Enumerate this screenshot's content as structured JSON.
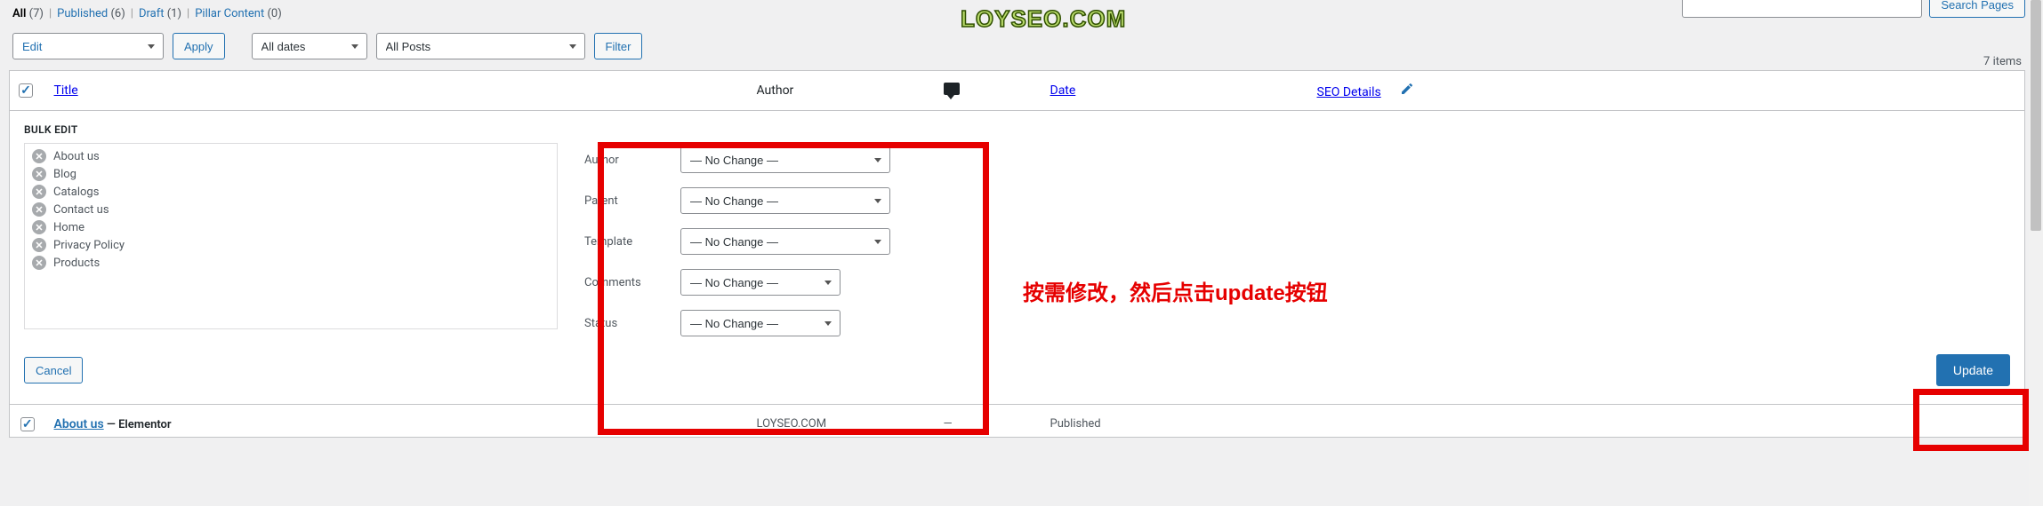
{
  "filters": {
    "all_label": "All",
    "all_count": "(7)",
    "published_label": "Published",
    "published_count": "(6)",
    "draft_label": "Draft",
    "draft_count": "(1)",
    "pillar_label": "Pillar Content",
    "pillar_count": "(0)"
  },
  "watermark": "LOYSEO.COM",
  "search": {
    "placeholder": "",
    "button": "Search Pages"
  },
  "toolbar": {
    "bulk_action": "Edit",
    "apply": "Apply",
    "dates": "All dates",
    "posts": "All Posts",
    "filter": "Filter",
    "items": "7 items"
  },
  "columns": {
    "title": "Title",
    "author": "Author",
    "date": "Date",
    "seo": "SEO Details"
  },
  "bulk": {
    "heading": "BULK EDIT",
    "items": [
      "About us",
      "Blog",
      "Catalogs",
      "Contact us",
      "Home",
      "Privacy Policy",
      "Products"
    ],
    "fields": {
      "author": "Author",
      "parent": "Parent",
      "template": "Template",
      "comments": "Comments",
      "status": "Status"
    },
    "no_change": "— No Change —",
    "cancel": "Cancel",
    "update": "Update"
  },
  "annotation": "按需修改，然后点击update按钮",
  "row": {
    "title": "About us",
    "state": " — Elementor",
    "author": "LOYSEO.COM",
    "date": "Published"
  }
}
